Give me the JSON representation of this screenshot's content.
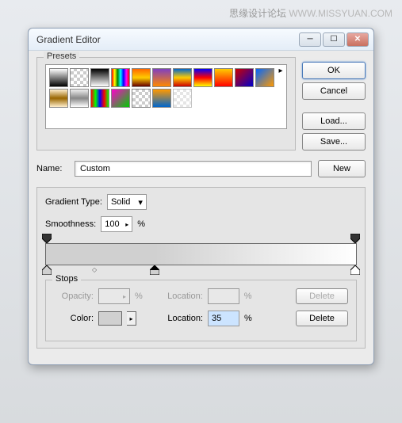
{
  "watermark": {
    "cn": "思缘设计论坛",
    "url": "WWW.MISSYUAN.COM"
  },
  "title": "Gradient Editor",
  "buttons": {
    "ok": "OK",
    "cancel": "Cancel",
    "load": "Load...",
    "save": "Save...",
    "new": "New",
    "delete": "Delete"
  },
  "labels": {
    "presets": "Presets",
    "name": "Name:",
    "gradient_type": "Gradient Type:",
    "smoothness": "Smoothness:",
    "stops": "Stops",
    "opacity": "Opacity:",
    "location": "Location:",
    "color": "Color:",
    "percent": "%"
  },
  "values": {
    "name": "Custom",
    "gradient_type": "Solid",
    "smoothness": "100",
    "opacity": "",
    "opacity_location": "",
    "color_location": "35"
  },
  "gradient": {
    "stops": [
      {
        "pos": 0,
        "color": "#d0d0d0"
      },
      {
        "pos": 35,
        "color": "#d0d0d0"
      },
      {
        "pos": 100,
        "color": "#ffffff"
      }
    ]
  }
}
